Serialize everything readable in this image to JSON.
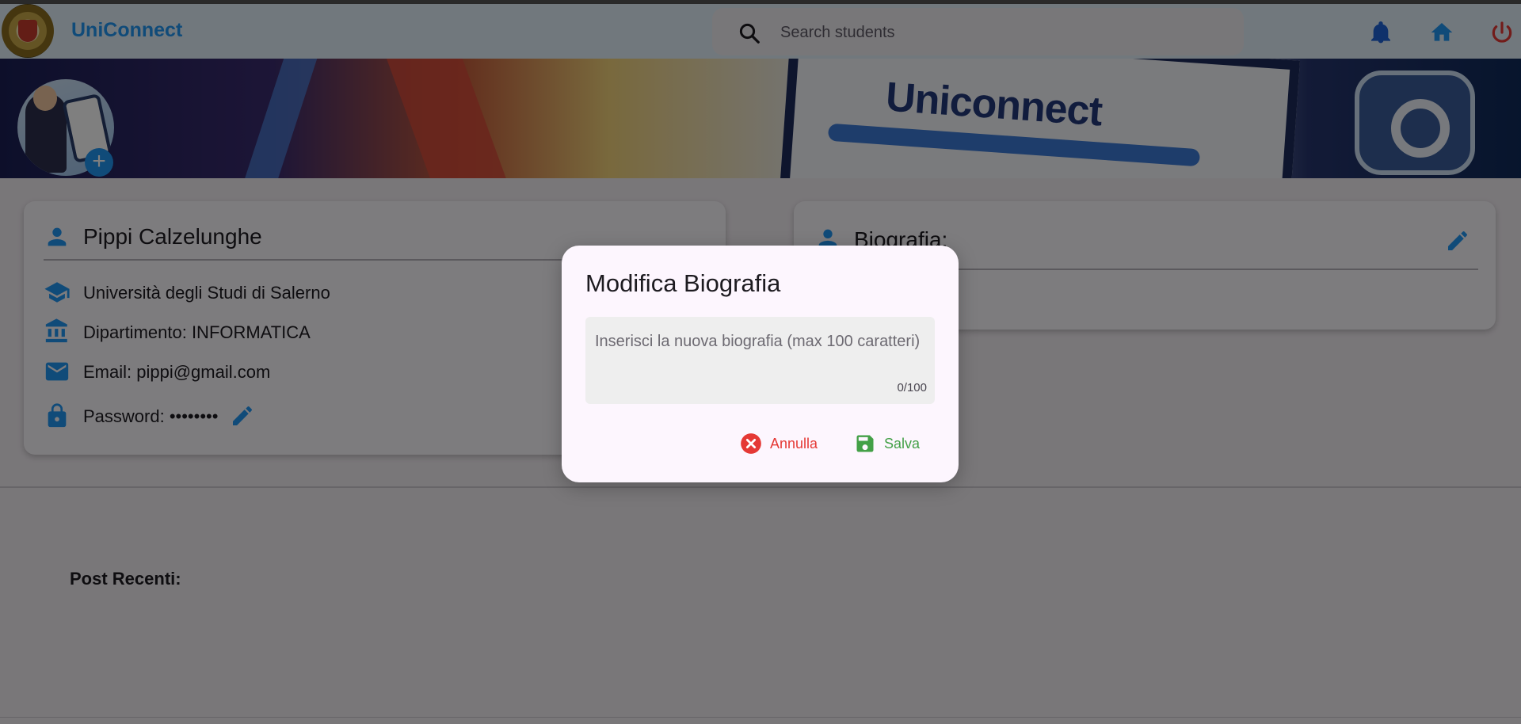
{
  "app": {
    "title": "UniConnect"
  },
  "search": {
    "placeholder": "Search students"
  },
  "appbar_icons": [
    "bell-icon",
    "home-icon",
    "power-icon"
  ],
  "banner": {
    "text": "Uniconnect"
  },
  "profile": {
    "name": "Pippi Calzelunghe",
    "university": "Università degli Studi di Salerno",
    "department": "Dipartimento: INFORMATICA",
    "email": "Email: pippi@gmail.com",
    "password": "Password: ••••••••"
  },
  "bio_card": {
    "title": "Biografia:"
  },
  "posts": {
    "title": "Post Recenti:"
  },
  "dialog": {
    "title": "Modifica Biografia",
    "field_placeholder": "Inserisci la nuova biografia (max 100 caratteri)",
    "field_value": "",
    "counter": "0/100",
    "cancel_label": "Annulla",
    "save_label": "Salva"
  },
  "colors": {
    "accent": "#2196f3",
    "cancel": "#e53935",
    "save": "#43a047",
    "notification": "#1e63d6",
    "logout": "#e53935"
  }
}
